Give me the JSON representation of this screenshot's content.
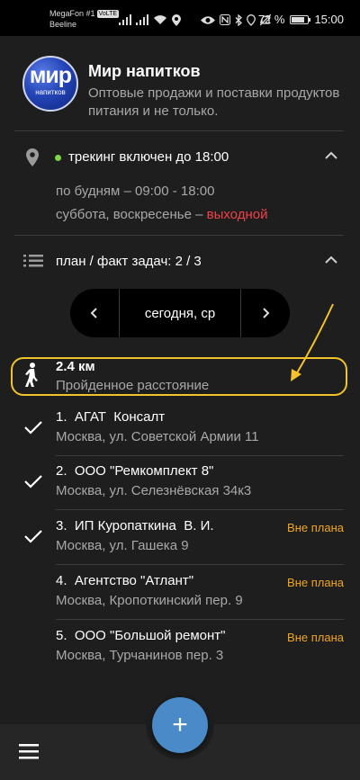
{
  "status_bar": {
    "carrier_1": "MegaFon #1",
    "volte": "VoLTE",
    "carrier_2": "Beeline",
    "battery": "72 %",
    "time": "15:00"
  },
  "header": {
    "logo_big": "мир",
    "logo_small": "напитков",
    "title": "Мир напитков",
    "subtitle": "Оптовые продажи и поставки продуктов питания и не только."
  },
  "tracking": {
    "status": "трекинг включен до 18:00",
    "weekdays": "по будням – 09:00 - 18:00",
    "weekend": "суббота, воскресенье – ",
    "weekend_off": "выходной"
  },
  "plan": {
    "label": "план / факт задач: 2 / 3"
  },
  "date_selector": {
    "label": "сегодня, ср"
  },
  "distance": {
    "value": "2.4 км",
    "label": "Пройденное расстояние"
  },
  "tasks": [
    {
      "name": "1.  АГАТ  Консалт",
      "address": "Москва, ул. Советской Армии 11",
      "done": true,
      "badge": ""
    },
    {
      "name": "2.  ООО \"Ремкомплект 8\"",
      "address": "Москва, ул. Селезнёвская 34к3",
      "done": true,
      "badge": ""
    },
    {
      "name": "3.  ИП Куропаткина  В. И.",
      "address": "Москва, ул. Гашека 9",
      "done": true,
      "badge": "Вне плана"
    },
    {
      "name": "4.  Агентство \"Атлант\"",
      "address": "Москва, Кропоткинский пер. 9",
      "done": false,
      "badge": "Вне плана"
    },
    {
      "name": "5.  ООО \"Большой ремонт\"",
      "address": "Москва, Турчанинов пер. 3",
      "done": false,
      "badge": "Вне плана"
    }
  ],
  "fab": {
    "label": "+"
  },
  "colors": {
    "background": "#1e1e1e",
    "accent_fab": "#4a8ac8",
    "highlight": "#f2c32a",
    "off_day": "#f0404a",
    "badge": "#f2a623",
    "tracking_dot": "#7fd64a"
  }
}
